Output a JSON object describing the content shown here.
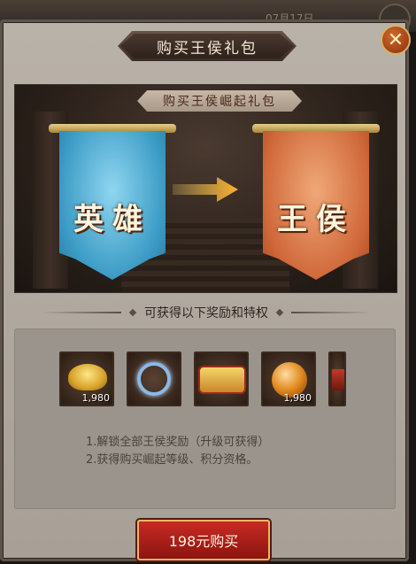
{
  "background": {
    "date": "07月17日"
  },
  "dialog": {
    "title": "购买王侯礼包",
    "close_icon": "close-icon"
  },
  "scene": {
    "subtitle": "购买王侯崛起礼包",
    "from_flag": "英雄",
    "to_flag": "王侯",
    "arrow_icon": "arrow-right-icon"
  },
  "rewards": {
    "header": "可获得以下奖励和特权",
    "items": [
      {
        "icon": "gold-ingot-icon",
        "count": "1,980"
      },
      {
        "icon": "ring-icon",
        "count": ""
      },
      {
        "icon": "title-badge-icon",
        "count": ""
      },
      {
        "icon": "orb-icon",
        "count": "1,980"
      },
      {
        "icon": "partial-item-icon",
        "count": ""
      }
    ],
    "desc_lines": [
      "1.解锁全部王侯奖励（升级可获得）",
      "2.获得购买崛起等级、积分资格。"
    ]
  },
  "buy_button": {
    "label": "198元购买"
  },
  "colors": {
    "accent": "#c82a24",
    "gold": "#e8b66a"
  }
}
